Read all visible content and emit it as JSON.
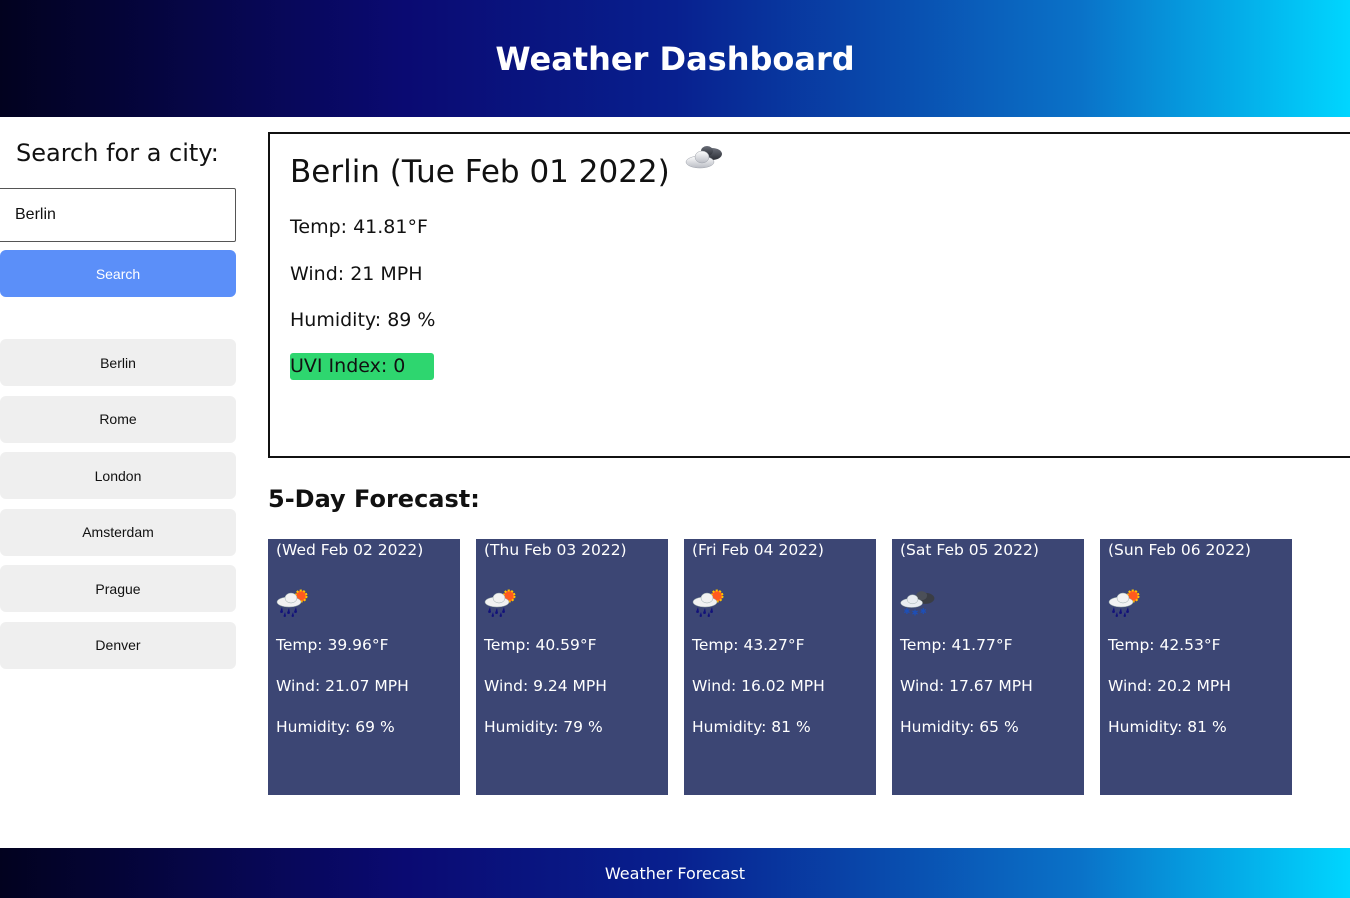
{
  "header": {
    "title": "Weather Dashboard"
  },
  "sidebar": {
    "title": "Search for a city:",
    "search_value": "Berlin",
    "search_button": "Search",
    "history": [
      "Berlin",
      "Rome",
      "London",
      "Amsterdam",
      "Prague",
      "Denver"
    ]
  },
  "current": {
    "title": "Berlin (Tue Feb 01 2022)",
    "icon": "cloud-moon-icon",
    "temp": "Temp: 41.81°F",
    "wind": "Wind: 21 MPH",
    "humidity": "Humidity: 89 %",
    "uvi": "UVI Index: 0",
    "uvi_color": "#2ed66f"
  },
  "forecast": {
    "title": "5-Day Forecast:",
    "days": [
      {
        "date": "(Wed Feb 02 2022)",
        "icon": "rain-sun-icon",
        "temp": "Temp: 39.96°F",
        "wind": "Wind: 21.07 MPH",
        "humidity": "Humidity: 69 %"
      },
      {
        "date": "(Thu Feb 03 2022)",
        "icon": "rain-sun-icon",
        "temp": "Temp: 40.59°F",
        "wind": "Wind: 9.24 MPH",
        "humidity": "Humidity: 79 %"
      },
      {
        "date": "(Fri Feb 04 2022)",
        "icon": "rain-sun-icon",
        "temp": "Temp: 43.27°F",
        "wind": "Wind: 16.02 MPH",
        "humidity": "Humidity: 81 %"
      },
      {
        "date": "(Sat Feb 05 2022)",
        "icon": "snow-cloud-icon",
        "temp": "Temp: 41.77°F",
        "wind": "Wind: 17.67 MPH",
        "humidity": "Humidity: 65 %"
      },
      {
        "date": "(Sun Feb 06 2022)",
        "icon": "rain-sun-icon",
        "temp": "Temp: 42.53°F",
        "wind": "Wind: 20.2 MPH",
        "humidity": "Humidity: 81 %"
      }
    ]
  },
  "footer": {
    "text": "Weather Forecast"
  },
  "colors": {
    "accent_button": "#5b8ff9",
    "forecast_card": "#3c4674",
    "history_button": "#efefef"
  }
}
